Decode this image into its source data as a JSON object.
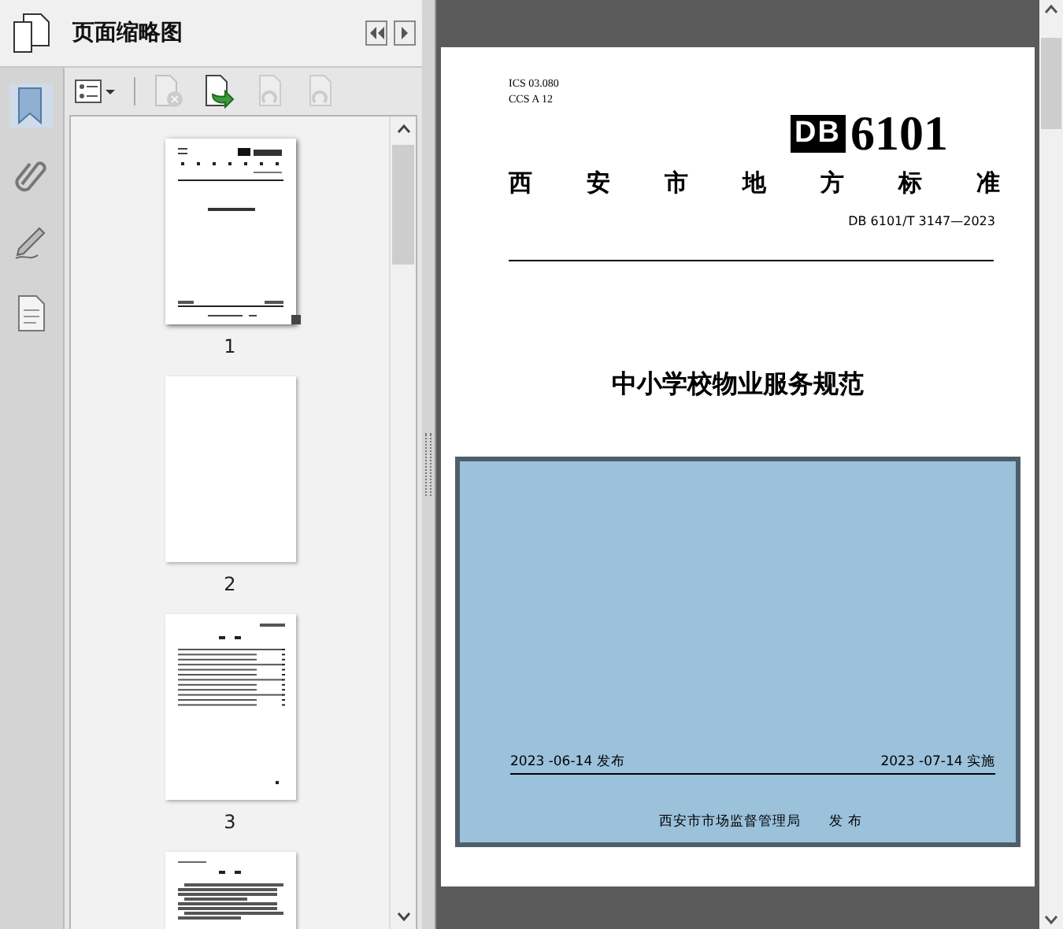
{
  "panel": {
    "title": "页面缩略图"
  },
  "rail": [
    {
      "kind": "bookmark",
      "selected": true
    },
    {
      "kind": "paperclip",
      "selected": false
    },
    {
      "kind": "signature",
      "selected": false
    },
    {
      "kind": "layers",
      "selected": false
    }
  ],
  "toolbar": [
    {
      "kind": "options",
      "disabled": false
    },
    {
      "kind": "delete",
      "disabled": true
    },
    {
      "kind": "insert",
      "disabled": false
    },
    {
      "kind": "rotate-left",
      "disabled": true
    },
    {
      "kind": "rotate-right",
      "disabled": true
    }
  ],
  "thumbnails": [
    {
      "kind": "cover",
      "label": "1",
      "selected": true
    },
    {
      "kind": "blank",
      "label": "2",
      "selected": false
    },
    {
      "kind": "contents",
      "label": "3",
      "selected": false
    },
    {
      "kind": "text",
      "selected": false
    }
  ],
  "document": {
    "ics_label": "ICS",
    "ics_code": "03.080",
    "ccs_label": "CCS",
    "ccs_code": "A 12",
    "logo_mark": "DB",
    "logo_number": "6101",
    "standard_type": [
      "西",
      "安",
      "市",
      "地",
      "方",
      "标",
      "准"
    ],
    "code": "DB 6101/T 3147—2023",
    "title": "中小学校物业服务规范",
    "issue_date": "2023 -06-14 发布",
    "effective_date": "2023 -07-14 实施",
    "issuer": "西安市市场监督管理局",
    "issue_word": "发 布"
  }
}
